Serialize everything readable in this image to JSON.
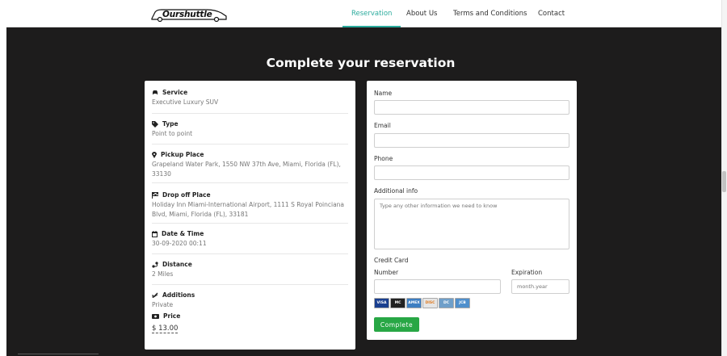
{
  "nav": {
    "logo_text": "Ourshuttle",
    "items": [
      "Reservation",
      "About Us",
      "Terms and Conditions",
      "Contact"
    ],
    "active_color": "#2bab9d"
  },
  "page": {
    "title": "Complete your reservation"
  },
  "summary": [
    {
      "icon": "car-icon",
      "title": "Service",
      "value": "Executive Luxury SUV"
    },
    {
      "icon": "tag-icon",
      "title": "Type",
      "value": "Point to point"
    },
    {
      "icon": "map-marker-icon",
      "title": "Pickup Place",
      "value": "Grapeland Water Park, 1550 NW 37th Ave, Miami, Florida (FL), 33130"
    },
    {
      "icon": "flag-icon",
      "title": "Drop off Place",
      "value": "Holiday Inn Miami-International Airport, 1111 S Royal Poinciana Blvd, Miami, Florida (FL), 33181"
    },
    {
      "icon": "calendar-icon",
      "title": "Date & Time",
      "value": "30-09-2020 00:11"
    },
    {
      "icon": "route-icon",
      "title": "Distance",
      "value": "2 Miles"
    },
    {
      "icon": "check-double-icon",
      "title": "Additions",
      "value": "Private"
    },
    {
      "icon": "money-icon",
      "title": "Price",
      "value": "$ 13.00"
    }
  ],
  "form": {
    "name_label": "Name",
    "email_label": "Email",
    "phone_label": "Phone",
    "info_label": "Additional info",
    "info_placeholder": "Type any other information we need to know",
    "credit_card_label": "Credit Card",
    "number_label": "Number",
    "expiration_label": "Expiration",
    "expiration_placeholder": "month.year",
    "card_brands": [
      {
        "name": "VISA",
        "color": "#1a3f8f"
      },
      {
        "name": "MC",
        "color": "#222222"
      },
      {
        "name": "AMEX",
        "color": "#3d7ec2"
      },
      {
        "name": "DISC",
        "color": "#e6e6e6"
      },
      {
        "name": "DC",
        "color": "#6f9fc9"
      },
      {
        "name": "JCB",
        "color": "#4f8fcc"
      }
    ],
    "submit_label": "Complete",
    "submit_color": "#28a745"
  }
}
